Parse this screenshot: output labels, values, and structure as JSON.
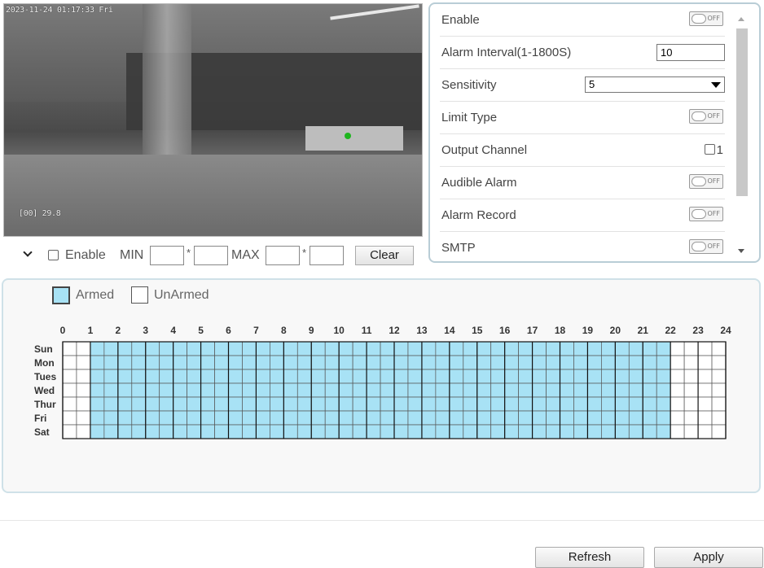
{
  "video": {
    "timestamp": "2023-11-24 01:17:33 Fri",
    "temperature": "[00] 29.8"
  },
  "region_bar": {
    "enable_label": "Enable",
    "min_label": "MIN",
    "max_label": "MAX",
    "star": "*",
    "clear_label": "Clear"
  },
  "settings": {
    "enable": {
      "label": "Enable",
      "state": "OFF"
    },
    "alarm_interval": {
      "label": "Alarm Interval(1-1800S)",
      "value": "10"
    },
    "sensitivity": {
      "label": "Sensitivity",
      "value": "5"
    },
    "limit_type": {
      "label": "Limit Type",
      "state": "OFF"
    },
    "output_channel": {
      "label": "Output Channel",
      "option": "1"
    },
    "audible_alarm": {
      "label": "Audible Alarm",
      "state": "OFF"
    },
    "alarm_record": {
      "label": "Alarm Record",
      "state": "OFF"
    },
    "smtp": {
      "label": "SMTP",
      "state": "OFF"
    }
  },
  "schedule": {
    "legend": {
      "armed": "Armed",
      "unarmed": "UnArmed"
    },
    "armed_color": "#a8e2f5",
    "unarmed_color": "#ffffff",
    "hour_labels": [
      "0",
      "1",
      "2",
      "3",
      "4",
      "5",
      "6",
      "7",
      "8",
      "9",
      "10",
      "11",
      "12",
      "13",
      "14",
      "15",
      "16",
      "17",
      "18",
      "19",
      "20",
      "21",
      "22",
      "23",
      "24"
    ],
    "days": [
      "Sun",
      "Mon",
      "Tues",
      "Wed",
      "Thur",
      "Fri",
      "Sat"
    ],
    "armed_hours": [
      1,
      22
    ]
  },
  "footer": {
    "refresh_label": "Refresh",
    "apply_label": "Apply"
  }
}
